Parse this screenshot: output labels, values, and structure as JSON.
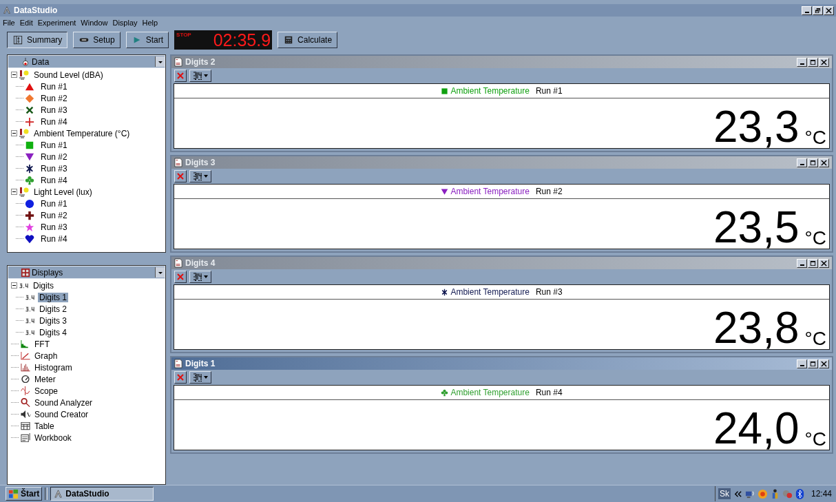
{
  "window": {
    "title": "DataStudio"
  },
  "menu": [
    "File",
    "Edit",
    "Experiment",
    "Window",
    "Display",
    "Help"
  ],
  "toolbar": {
    "buttons": [
      {
        "label": "Summary",
        "kind": "summary",
        "selected": true
      },
      {
        "label": "Setup",
        "kind": "setup",
        "selected": false
      },
      {
        "label": "Start",
        "kind": "start",
        "selected": false
      }
    ],
    "timer": {
      "status": "STOP",
      "time": "02:35.9"
    },
    "calculate": "Calculate"
  },
  "data_panel": {
    "title": "Data",
    "items": [
      {
        "label": "Sound Level (dBA)",
        "expanded": true,
        "children": [
          {
            "label": "Run #1",
            "kind": "triangle",
            "color": "#e01010"
          },
          {
            "label": "Run #2",
            "kind": "diamond",
            "color": "#f07830"
          },
          {
            "label": "Run #3",
            "kind": "x",
            "color": "#1a5a1a"
          },
          {
            "label": "Run #4",
            "kind": "crosshair",
            "color": "#d02020"
          }
        ]
      },
      {
        "label": "Ambient Temperature (°C)",
        "expanded": true,
        "children": [
          {
            "label": "Run #1",
            "kind": "square",
            "color": "#10b010"
          },
          {
            "label": "Run #2",
            "kind": "triangle-down",
            "color": "#8a20c0"
          },
          {
            "label": "Run #3",
            "kind": "asterisk",
            "color": "#101850"
          },
          {
            "label": "Run #4",
            "kind": "club",
            "color": "#30a030"
          }
        ]
      },
      {
        "label": "Light Level (lux)",
        "expanded": true,
        "children": [
          {
            "label": "Run #1",
            "kind": "circle",
            "color": "#1020e0"
          },
          {
            "label": "Run #2",
            "kind": "plus",
            "color": "#701010"
          },
          {
            "label": "Run #3",
            "kind": "star",
            "color": "#e040e0"
          },
          {
            "label": "Run #4",
            "kind": "heart",
            "color": "#1010c0"
          }
        ]
      }
    ]
  },
  "displays_panel": {
    "title": "Displays",
    "items": [
      {
        "label": "Digits",
        "kind": "digits",
        "expanded": true,
        "children": [
          {
            "label": "Digits 1",
            "kind": "digits",
            "selected": true
          },
          {
            "label": "Digits 2",
            "kind": "digits",
            "selected": false
          },
          {
            "label": "Digits 3",
            "kind": "digits",
            "selected": false
          },
          {
            "label": "Digits 4",
            "kind": "digits",
            "selected": false
          }
        ]
      },
      {
        "label": "FFT",
        "kind": "fft"
      },
      {
        "label": "Graph",
        "kind": "graph"
      },
      {
        "label": "Histogram",
        "kind": "histogram"
      },
      {
        "label": "Meter",
        "kind": "meter"
      },
      {
        "label": "Scope",
        "kind": "scope"
      },
      {
        "label": "Sound Analyzer",
        "kind": "analyzer"
      },
      {
        "label": "Sound Creator",
        "kind": "speaker"
      },
      {
        "label": "Table",
        "kind": "table"
      },
      {
        "label": "Workbook",
        "kind": "workbook"
      }
    ]
  },
  "windows": [
    {
      "title": "Digits 2",
      "active": false,
      "legend": {
        "kind": "square",
        "color": "#10a010",
        "measurement": "Ambient Temperature",
        "run": "Run #1"
      },
      "value": "23,3",
      "unit": "°C"
    },
    {
      "title": "Digits 3",
      "active": false,
      "legend": {
        "kind": "triangle-down",
        "color": "#8a20c0",
        "measurement": "Ambient Temperature",
        "run": "Run #2"
      },
      "value": "23,5",
      "unit": "°C"
    },
    {
      "title": "Digits 4",
      "active": false,
      "legend": {
        "kind": "asterisk",
        "color": "#101850",
        "measurement": "Ambient Temperature",
        "run": "Run #3"
      },
      "value": "23,8",
      "unit": "°C"
    },
    {
      "title": "Digits 1",
      "active": true,
      "legend": {
        "kind": "club",
        "color": "#30a030",
        "measurement": "Ambient Temperature",
        "run": "Run #4"
      },
      "value": "24,0",
      "unit": "°C"
    }
  ],
  "taskbar": {
    "start": "Štart",
    "task": "DataStudio",
    "language": "Sk",
    "clock": "12:44"
  }
}
